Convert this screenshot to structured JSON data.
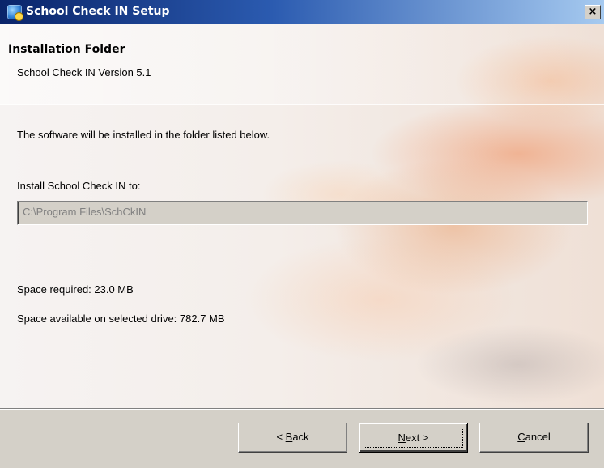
{
  "window": {
    "title": "School Check IN Setup",
    "close_glyph": "×"
  },
  "header": {
    "title": "Installation Folder",
    "subtitle": "School Check IN Version 5.1"
  },
  "body": {
    "description": "The software will be installed in the folder listed below.",
    "install_label": "Install School Check IN to:",
    "install_path": "C:\\Program Files\\SchCkIN",
    "space_required": "Space required: 23.0 MB",
    "space_available": "Space available on selected drive: 782.7 MB"
  },
  "buttons": {
    "back": {
      "prefix": "< ",
      "accel": "B",
      "rest": "ack"
    },
    "next": {
      "accel": "N",
      "rest": "ext >"
    },
    "cancel": {
      "accel": "C",
      "rest": "ancel"
    }
  },
  "icons": {
    "app_icon": "setup-icon",
    "close_icon": "close-icon"
  },
  "colors": {
    "titlebar_start": "#0a246a",
    "titlebar_end": "#a6caf0",
    "dialog_face": "#d4d0c8",
    "disabled_text": "#808080"
  }
}
